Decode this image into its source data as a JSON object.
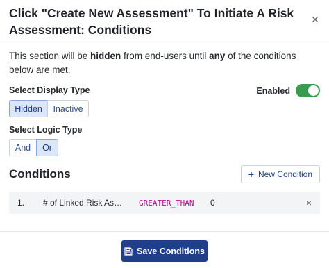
{
  "header": {
    "title": "Click \"Create New Assessment\" To Initiate A Risk Assessment: Conditions",
    "close_glyph": "×"
  },
  "description": {
    "part1": "This section will be ",
    "bold1": "hidden",
    "part2": " from end-users until ",
    "bold2": "any",
    "part3": " of the conditions below are met."
  },
  "display_type": {
    "label": "Select Display Type",
    "options": [
      "Hidden",
      "Inactive"
    ],
    "selected": "Hidden"
  },
  "enabled": {
    "label": "Enabled",
    "on": true,
    "color": "#3a9a4d"
  },
  "logic_type": {
    "label": "Select Logic Type",
    "options": [
      "And",
      "Or"
    ],
    "selected": "Or"
  },
  "conditions": {
    "heading": "Conditions",
    "new_button_label": "New Condition",
    "rows": [
      {
        "index": "1.",
        "field": "# of Linked Risk Assessments",
        "operator": "GREATER_THAN",
        "value": "0"
      }
    ]
  },
  "footer": {
    "save_label": "Save Conditions",
    "save_color": "#1f3f8a",
    "save_icon": "floppy-disk-icon"
  }
}
